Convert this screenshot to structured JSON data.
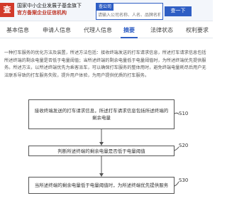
{
  "header": {
    "logo_text": "查",
    "brand_line1": "国家中小企业发展子基金旗下",
    "brand_line2": "官方备案企业征信机构",
    "search_tab": "查公司",
    "search_placeholder": "请输入公司名称、人名、品牌名称等关键词",
    "search_button": "查一下"
  },
  "tabs": [
    {
      "label": "基本信息",
      "active": false
    },
    {
      "label": "申请人信息",
      "active": false
    },
    {
      "label": "代理人信息",
      "active": false
    },
    {
      "label": "摘要",
      "active": true
    },
    {
      "label": "法律状态",
      "active": false
    },
    {
      "label": "权利要求",
      "active": false
    }
  ],
  "abstract": "一种打车服务的优化方法及装置，所述方法包括：接收终端发送的打车请求信息，所述打车请求信息包括所述终端的剩余电量是否低于电量阈值；当所述终端的剩余电量低于电量阈值时，为所述终端优先提供服务。所述方法，以所述终端优先为乘客派车，可以确保打车服务的整体用时，避免终端电量耗尽后用户无法联系导致的打车服务失败，提升用户体验，为用户提供优质的打车服务。",
  "diagram": {
    "steps": [
      {
        "id": "S10",
        "text": "接收终端发送的打车请求信息，所述打车请求信息包括所述终端的剩余电量"
      },
      {
        "id": "S20",
        "text": "判断所述终端的剩余电量是否低于电量阈值"
      },
      {
        "id": "S30",
        "text": "当所述终端的剩余电量低于电量阈值时，为所述终端优先提供服务"
      }
    ]
  }
}
